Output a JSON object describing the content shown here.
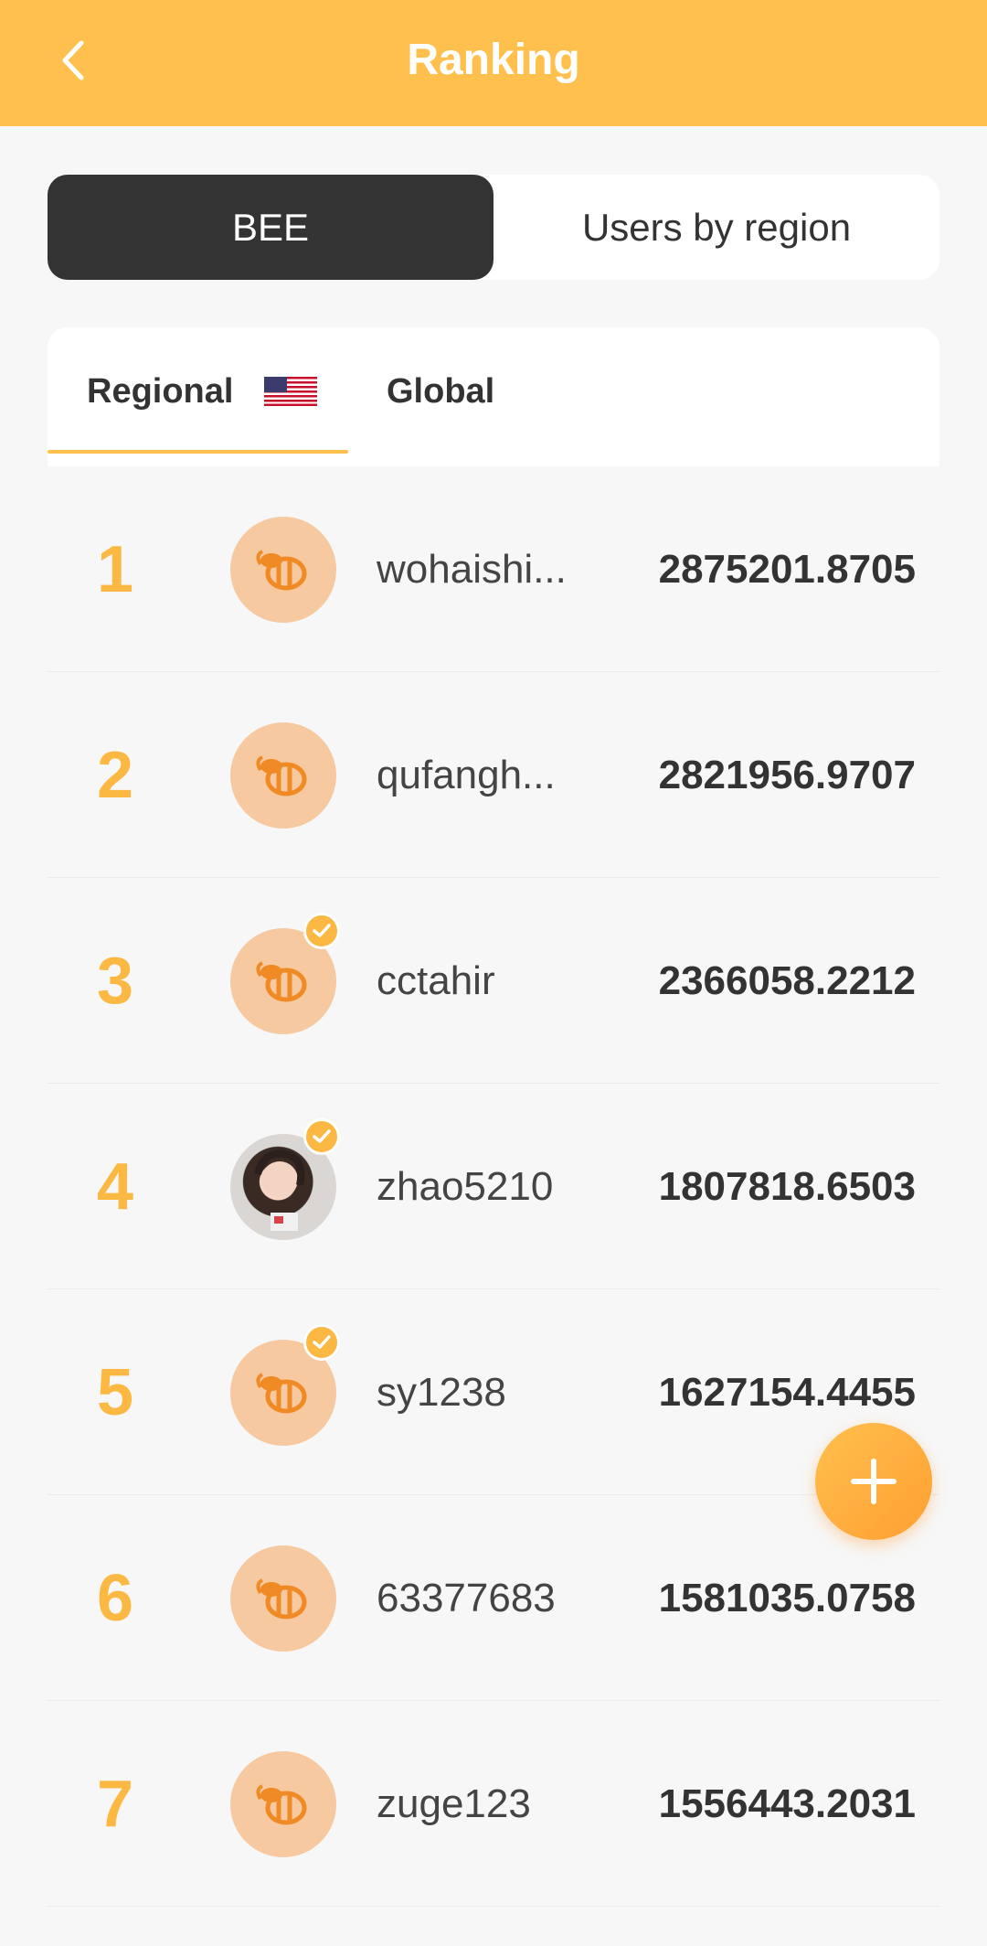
{
  "header": {
    "title": "Ranking",
    "back_icon": "chevron-left-icon",
    "color": "#ffc04d"
  },
  "segments": [
    {
      "label": "BEE",
      "active": true
    },
    {
      "label": "Users by region",
      "active": false
    }
  ],
  "tabs": [
    {
      "label": "Regional",
      "active": true,
      "flag_icon": "us-flag-icon"
    },
    {
      "label": "Global",
      "active": false
    }
  ],
  "rankings": [
    {
      "rank": "1",
      "username": "wohaishi...",
      "score": "2875201.8705",
      "verified": false,
      "avatar": "bee-icon"
    },
    {
      "rank": "2",
      "username": "qufangh...",
      "score": "2821956.9707",
      "verified": false,
      "avatar": "bee-icon"
    },
    {
      "rank": "3",
      "username": "cctahir",
      "score": "2366058.2212",
      "verified": true,
      "avatar": "bee-icon"
    },
    {
      "rank": "4",
      "username": "zhao5210",
      "score": "1807818.6503",
      "verified": true,
      "avatar": "photo"
    },
    {
      "rank": "5",
      "username": "sy1238",
      "score": "1627154.4455",
      "verified": true,
      "avatar": "bee-icon"
    },
    {
      "rank": "6",
      "username": "63377683",
      "score": "1581035.0758",
      "verified": false,
      "avatar": "bee-icon"
    },
    {
      "rank": "7",
      "username": "zuge123",
      "score": "1556443.2031",
      "verified": false,
      "avatar": "bee-icon"
    }
  ],
  "fab": {
    "icon": "plus-icon"
  }
}
